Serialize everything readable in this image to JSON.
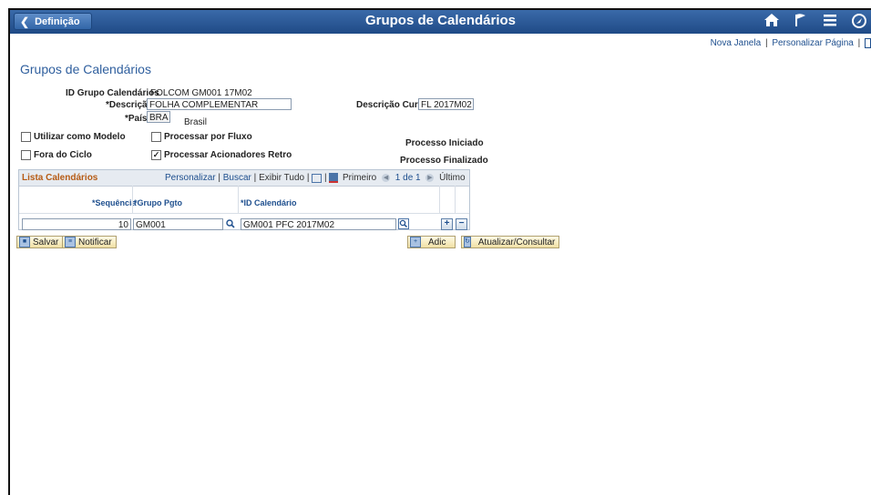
{
  "topbar": {
    "back_label": "Definição",
    "title": "Grupos de Calendários",
    "icons": [
      "home-icon",
      "flag-icon",
      "menu-icon",
      "navbar-icon"
    ]
  },
  "toplinks": {
    "new_window": "Nova Janela",
    "personalize": "Personalizar Página",
    "separator": "|"
  },
  "page": {
    "title": "Grupos de Calendários"
  },
  "form": {
    "id_label": "ID Grupo Calendários",
    "id_value": "FOLCOM GM001 17M02",
    "desc_label": "*Descrição",
    "desc_value": "FOLHA COMPLEMENTAR",
    "short_desc_label": "Descrição Curta",
    "short_desc_value": "FL 2017M02",
    "country_label": "*País",
    "country_value": "BRA",
    "country_name": "Brasil",
    "use_as_model": "Utilizar como Modelo",
    "process_by_flow": "Processar por Fluxo",
    "out_of_cycle": "Fora do Ciclo",
    "process_retro": "Processar Acionadores Retro",
    "process_started": "Processo Iniciado",
    "process_finished": "Processo Finalizado",
    "checked_mark": "✓"
  },
  "grid": {
    "title": "Lista Calendários",
    "personalize": "Personalizar",
    "search": "Buscar",
    "show_all": "Exibir Tudo",
    "sep": "|",
    "first": "Primeiro",
    "range": "1 de 1",
    "last": "Último",
    "columns": [
      "*Sequência",
      "*Grupo Pgto",
      "*ID Calendário"
    ],
    "rows": [
      {
        "seq": "10",
        "pay_group": "GM001",
        "calendar_id": "GM001 PFC 2017M02"
      }
    ],
    "add_symbol": "+",
    "remove_symbol": "−"
  },
  "buttons": {
    "save": "Salvar",
    "notify": "Notificar",
    "add": "Adic",
    "update": "Atualizar/Consultar"
  }
}
